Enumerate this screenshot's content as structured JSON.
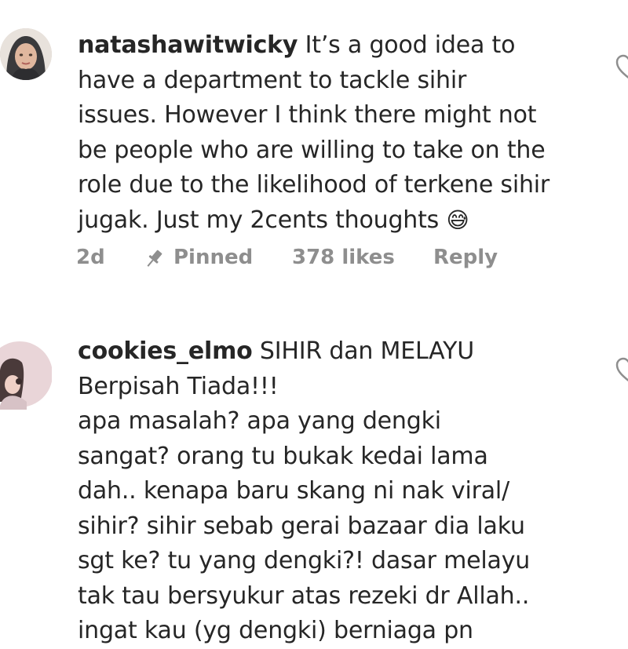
{
  "comments": [
    {
      "username": "natashawitwicky",
      "lines": [
        " It’s a good idea to",
        "have a department to tackle sihir",
        "issues. However I think there might not",
        "be people who are willing to take on the",
        "role due to the likelihood of terkene sihir",
        "jugak. Just my 2cents thoughts"
      ],
      "emoji": "😅",
      "time": "2d",
      "pinned_label": "Pinned",
      "likes": "378 likes",
      "reply_label": "Reply",
      "avatar_icon": "hijab-woman-avatar"
    },
    {
      "username": "cookies_elmo",
      "lines": [
        " SIHIR dan MELAYU",
        "Berpisah Tiada!!!",
        "apa masalah? apa yang dengki",
        "sangat? orang tu bukak kedai lama",
        "dah.. kenapa baru skang ni nak viral/",
        "sihir? sihir sebab gerai bazaar dia laku",
        "sgt ke? tu yang dengki?! dasar melayu",
        "tak tau bersyukur atas rezeki dr Allah..",
        "ingat kau (yg dengki) berniaga pn"
      ],
      "avatar_icon": "girl-avatar"
    }
  ],
  "colors": {
    "text": "#262626",
    "meta": "#8e8e8e",
    "avatar_ring": "#dbdbdb"
  }
}
